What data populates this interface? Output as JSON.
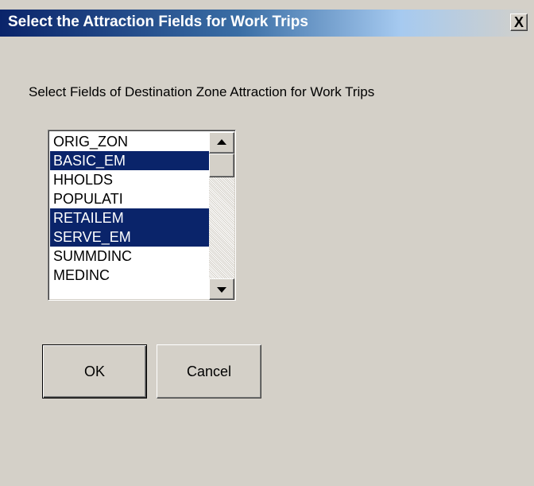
{
  "window": {
    "title": "Select the Attraction Fields for Work Trips",
    "close_label": "X"
  },
  "prompt": "Select Fields of Destination Zone Attraction for Work Trips",
  "listbox": {
    "items": [
      {
        "label": "ORIG_ZON",
        "selected": false
      },
      {
        "label": "BASIC_EM",
        "selected": true
      },
      {
        "label": "HHOLDS",
        "selected": false
      },
      {
        "label": "POPULATI",
        "selected": false
      },
      {
        "label": "RETAILEM",
        "selected": true
      },
      {
        "label": "SERVE_EM",
        "selected": true
      },
      {
        "label": "SUMMDINC",
        "selected": false
      },
      {
        "label": "MEDINC",
        "selected": false
      }
    ]
  },
  "buttons": {
    "ok_label": "OK",
    "cancel_label": "Cancel"
  },
  "colors": {
    "selection": "#0a246a",
    "face": "#d4d0c8"
  }
}
